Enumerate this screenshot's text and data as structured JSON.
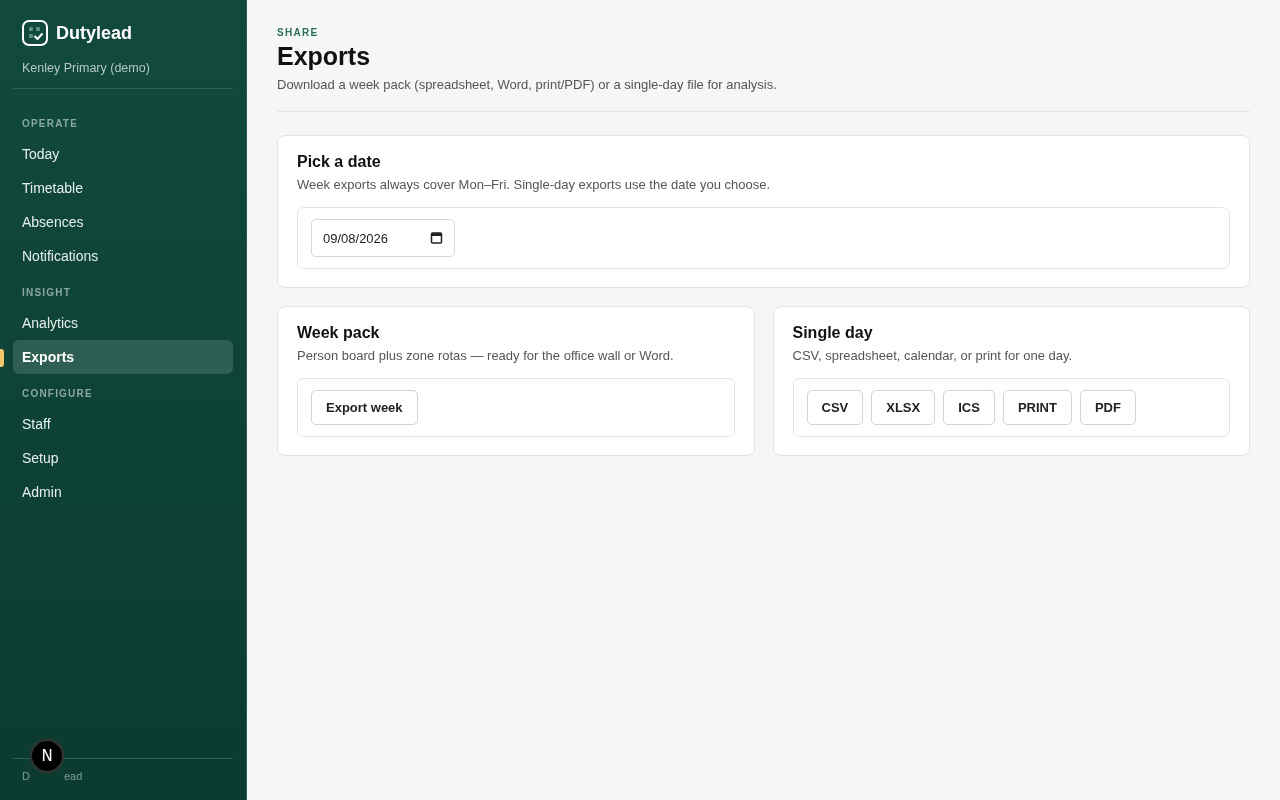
{
  "sidebar": {
    "brand": "Dutylead",
    "school": "Kenley Primary (demo)",
    "sections": [
      {
        "heading": "OPERATE",
        "items": [
          {
            "label": "Today",
            "selected": false
          },
          {
            "label": "Timetable",
            "selected": false
          },
          {
            "label": "Absences",
            "selected": false
          },
          {
            "label": "Notifications",
            "selected": false
          }
        ]
      },
      {
        "heading": "INSIGHT",
        "items": [
          {
            "label": "Analytics",
            "selected": false
          },
          {
            "label": "Exports",
            "selected": true
          }
        ]
      },
      {
        "heading": "CONFIGURE",
        "items": [
          {
            "label": "Staff",
            "selected": false
          },
          {
            "label": "Setup",
            "selected": false
          },
          {
            "label": "Admin",
            "selected": false
          }
        ]
      }
    ],
    "footer_parts": [
      "D",
      "ead"
    ],
    "badge": "N"
  },
  "header": {
    "eyebrow": "SHARE",
    "title": "Exports",
    "subtitle": "Download a week pack (spreadsheet, Word, print/PDF) or a single-day file for analysis."
  },
  "date_card": {
    "title": "Pick a date",
    "description": "Week exports always cover Mon–Fri. Single-day exports use the date you choose.",
    "date_value": "09/08/2026"
  },
  "cards": [
    {
      "title": "Week pack",
      "description": "Person board plus zone rotas — ready for the office wall or Word.",
      "buttons": [
        "Export week"
      ]
    },
    {
      "title": "Single day",
      "description": "CSV, spreadsheet, calendar, or print for one day.",
      "buttons": [
        "CSV",
        "XLSX",
        "ICS",
        "PRINT",
        "PDF"
      ]
    }
  ]
}
